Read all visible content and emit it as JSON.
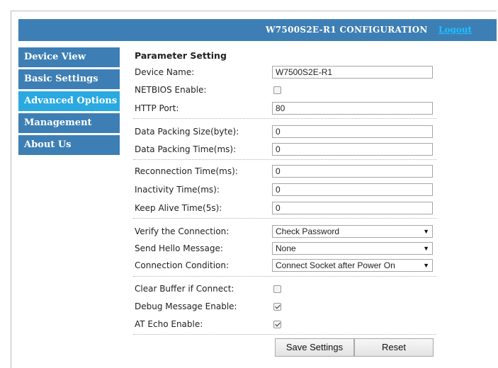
{
  "header": {
    "title": "W7500S2E-R1 CONFIGURATION",
    "logout": "Logout",
    "color": "#3d7fb5",
    "logout_color": "#1ec0ff"
  },
  "sidebar": {
    "items": [
      {
        "label": "Device View",
        "active": false
      },
      {
        "label": "Basic Settings",
        "active": false
      },
      {
        "label": "Advanced Options",
        "active": true
      },
      {
        "label": "Management",
        "active": false
      },
      {
        "label": "About Us",
        "active": false
      }
    ],
    "active_color": "#29a9e0"
  },
  "form": {
    "section_title": "Parameter Setting",
    "device_name": {
      "label": "Device Name:",
      "value": "W7500S2E-R1"
    },
    "netbios": {
      "label": "NETBIOS Enable:",
      "checked": false
    },
    "http_port": {
      "label": "HTTP Port:",
      "value": "80"
    },
    "packing_size": {
      "label": "Data Packing Size(byte):",
      "value": "0"
    },
    "packing_time": {
      "label": "Data Packing Time(ms):",
      "value": "0"
    },
    "reconnect_time": {
      "label": "Reconnection Time(ms):",
      "value": "0"
    },
    "inactivity_time": {
      "label": "Inactivity Time(ms):",
      "value": "0"
    },
    "keepalive_time": {
      "label": "Keep Alive Time(5s):",
      "value": "0"
    },
    "verify_conn": {
      "label": "Verify the Connection:",
      "value": "Check Password"
    },
    "hello_msg": {
      "label": "Send Hello Message:",
      "value": "None"
    },
    "conn_cond": {
      "label": "Connection Condition:",
      "value": "Connect Socket after Power On"
    },
    "clear_buffer": {
      "label": "Clear Buffer if Connect:",
      "checked": false
    },
    "debug_msg": {
      "label": "Debug Message Enable:",
      "checked": true
    },
    "at_echo": {
      "label": "AT Echo Enable:",
      "checked": true
    }
  },
  "buttons": {
    "save": "Save Settings",
    "reset": "Reset"
  },
  "icons": {
    "select_arrow": "dropdown-arrow-icon",
    "checkmark": "checkmark-icon"
  }
}
